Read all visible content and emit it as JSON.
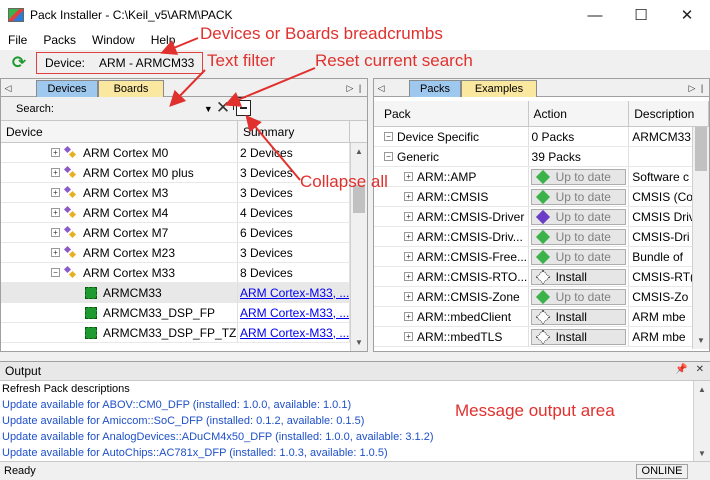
{
  "window": {
    "title": "Pack Installer - C:\\Keil_v5\\ARM\\PACK",
    "minimize": "—",
    "maximize": "☐",
    "close": "✕"
  },
  "menu": [
    "File",
    "Packs",
    "Window",
    "Help"
  ],
  "toolbar": {
    "device_label": "Device:",
    "device_value": "ARM - ARMCM33"
  },
  "left_panel": {
    "tabs": [
      "Devices",
      "Boards"
    ],
    "search_label": "Search:",
    "search_value": "",
    "columns": [
      "Device",
      "Summary"
    ],
    "rows": [
      {
        "name": "ARM Cortex M0",
        "summary": "2 Devices"
      },
      {
        "name": "ARM Cortex M0 plus",
        "summary": "3 Devices"
      },
      {
        "name": "ARM Cortex M3",
        "summary": "3 Devices"
      },
      {
        "name": "ARM Cortex M4",
        "summary": "4 Devices"
      },
      {
        "name": "ARM Cortex M7",
        "summary": "6 Devices"
      },
      {
        "name": "ARM Cortex M23",
        "summary": "3 Devices"
      },
      {
        "name": "ARM Cortex M33",
        "summary": "8 Devices"
      },
      {
        "name": "ARMCM33",
        "summary": "ARM Cortex-M33, ..."
      },
      {
        "name": "ARMCM33_DSP_FP",
        "summary": "ARM Cortex-M33, ..."
      },
      {
        "name": "ARMCM33_DSP_FP_TZ",
        "summary": "ARM Cortex-M33, ..."
      }
    ]
  },
  "right_panel": {
    "tabs": [
      "Packs",
      "Examples"
    ],
    "columns": [
      "Pack",
      "Action",
      "Description"
    ],
    "rows": [
      {
        "name": "Device Specific",
        "action": "0 Packs",
        "desc": "ARMCM33"
      },
      {
        "name": "Generic",
        "action": "39 Packs",
        "desc": ""
      },
      {
        "name": "ARM::AMP",
        "action": "Up to date",
        "desc": "Software c"
      },
      {
        "name": "ARM::CMSIS",
        "action": "Up to date",
        "desc": "CMSIS (Co"
      },
      {
        "name": "ARM::CMSIS-Driver",
        "action": "Up to date",
        "desc": "CMSIS Driv"
      },
      {
        "name": "ARM::CMSIS-Driv...",
        "action": "Up to date",
        "desc": "CMSIS-Dri"
      },
      {
        "name": "ARM::CMSIS-Free...",
        "action": "Up to date",
        "desc": "Bundle of"
      },
      {
        "name": "ARM::CMSIS-RTO...",
        "action": "Install",
        "desc": "CMSIS-RT("
      },
      {
        "name": "ARM::CMSIS-Zone",
        "action": "Up to date",
        "desc": "CMSIS-Zo"
      },
      {
        "name": "ARM::mbedClient",
        "action": "Install",
        "desc": "ARM mbe"
      },
      {
        "name": "ARM::mbedTLS",
        "action": "Install",
        "desc": "ARM mbe"
      }
    ]
  },
  "output": {
    "title": "Output",
    "lines": [
      "Refresh Pack descriptions",
      "Update available for ABOV::CM0_DFP (installed: 1.0.0,  available: 1.0.1)",
      "Update available for Amiccom::SoC_DFP (installed: 0.1.2,  available: 0.1.5)",
      "Update available for AnalogDevices::ADuCM4x50_DFP (installed: 1.0.0,  available: 3.1.2)",
      "Update available for AutoChips::AC781x_DFP (installed: 1.0.3,  available: 1.0.5)"
    ]
  },
  "status": {
    "left": "Ready",
    "right": "ONLINE"
  },
  "annotations": {
    "breadcrumbs": "Devices or Boards breadcrumbs",
    "text_filter": "Text filter",
    "reset_search": "Reset current search",
    "collapse_all": "Collapse all",
    "message_area": "Message output area"
  },
  "colors": {
    "annotation": "#e0312e",
    "active_tab": "#9fc8ee",
    "inactive_tab": "#fbe8a0",
    "link": "#0000ee",
    "output_blue": "#1e50c8"
  }
}
